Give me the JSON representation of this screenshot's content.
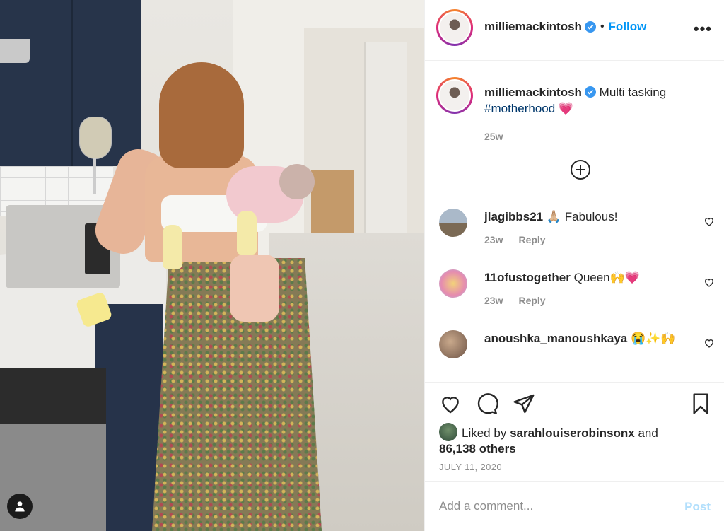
{
  "post": {
    "username": "milliemackintosh",
    "separator": "•",
    "follow_label": "Follow",
    "more_label": "•••",
    "verified_icon": "verified-badge-icon",
    "accent_color": "#0095f6"
  },
  "caption": {
    "username": "milliemackintosh",
    "text": "Multi tasking",
    "hashtag": "#motherhood",
    "emoji": "💗",
    "time": "25w"
  },
  "comments": [
    {
      "username": "jlagibbs21",
      "text": "🙏🏼 Fabulous!",
      "time": "23w",
      "reply_label": "Reply"
    },
    {
      "username": "11ofustogether",
      "text": "Queen🙌💗",
      "time": "23w",
      "reply_label": "Reply"
    },
    {
      "username": "anoushka_manoushkaya",
      "text": "😭✨🙌",
      "time": "",
      "reply_label": ""
    }
  ],
  "likes": {
    "prefix": "Liked by",
    "user": "sarahlouiserobinsonx",
    "conjunction": "and",
    "count": "86,138 others"
  },
  "date": "JULY 11, 2020",
  "add_comment": {
    "placeholder": "Add a comment...",
    "post_label": "Post"
  }
}
